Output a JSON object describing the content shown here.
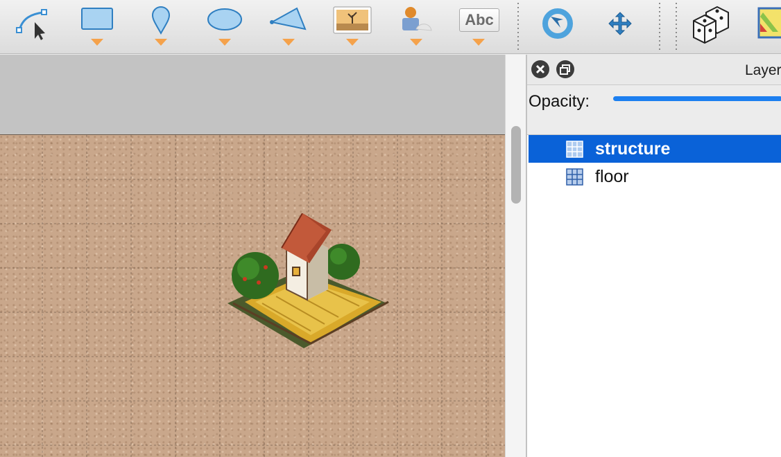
{
  "toolbar": {
    "tools": [
      {
        "name": "edit-polygon-tool",
        "icon": "node-edit-icon"
      },
      {
        "name": "rectangle-tool",
        "icon": "rectangle-icon"
      },
      {
        "name": "point-tool",
        "icon": "map-pin-icon"
      },
      {
        "name": "ellipse-tool",
        "icon": "ellipse-icon"
      },
      {
        "name": "polygon-tool",
        "icon": "polygon-icon"
      },
      {
        "name": "image-tool",
        "icon": "image-icon"
      },
      {
        "name": "template-tool",
        "icon": "template-icon"
      },
      {
        "name": "text-tool",
        "icon": "text-icon",
        "label": "Abc"
      },
      {
        "name": "rotate-tool",
        "icon": "rotate-icon"
      },
      {
        "name": "move-tool",
        "icon": "move-icon"
      },
      {
        "name": "random-mode-tool",
        "icon": "dice-icon"
      },
      {
        "name": "wang-fill-tool",
        "icon": "terrain-icon"
      }
    ],
    "accent": "#f5a24b"
  },
  "layers_panel": {
    "title": "Layers",
    "close_icon": "close-icon",
    "float_icon": "float-icon",
    "opacity_label": "Opacity:",
    "opacity": 1.0,
    "layers": [
      {
        "name": "structure",
        "selected": true
      },
      {
        "name": "floor",
        "selected": false
      }
    ],
    "selection_color": "#0a62d8"
  }
}
